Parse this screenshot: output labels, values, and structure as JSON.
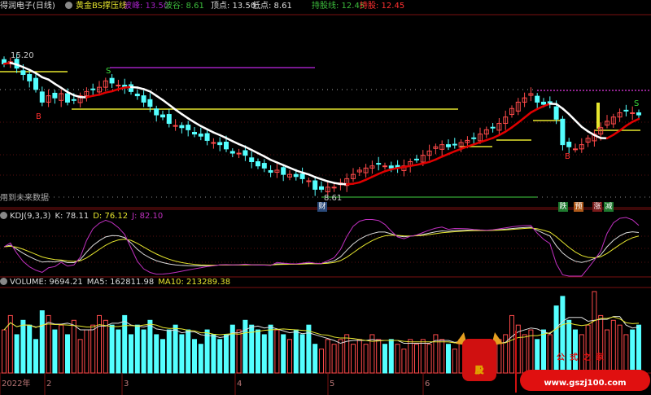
{
  "header": {
    "stock": "得润电子(日线)",
    "indicator": "黄金BS撑压线",
    "peak_label": "波峰: 13.50",
    "trough_label": "波谷: 8.61",
    "top_label": "顶点: 13.50",
    "bottom_label": "低点: 8.61",
    "hold_line_label": "持股线: 12.45",
    "hold_label": "持股: 12.45"
  },
  "main": {
    "high_marker": "15.20",
    "low_marker": "8.61",
    "future_warning": "用到未来数据",
    "signals": {
      "buy": "B",
      "sell": "S"
    },
    "badges": [
      "财",
      "跌",
      "预",
      "涨",
      "减"
    ],
    "colors": {
      "up": "#ff4a4a",
      "down": "#54ffff",
      "ma_fall": "#ffffff",
      "ma_rise": "#e00000",
      "support": "#e6e62e",
      "resist": "#a020c0"
    }
  },
  "kdj": {
    "title": "KDJ(9,3,3)",
    "k": "K: 78.11",
    "d": "D: 76.12",
    "j": "J: 82.10"
  },
  "volume": {
    "title": "VOLUME: 9694.21",
    "ma5": "MA5: 162811.98",
    "ma10": "MA10: 213289.38"
  },
  "axis": {
    "labels": [
      "2022年",
      "2",
      "3",
      "4",
      "5",
      "6"
    ]
  },
  "watermark": {
    "char": "股",
    "name": "公式之家",
    "url": "www.gszj100.com"
  },
  "chart_data": {
    "type": "candlestick",
    "closes": [
      14.8,
      14.9,
      14.6,
      14.3,
      14.0,
      13.6,
      13.0,
      13.3,
      13.2,
      13.4,
      13.0,
      13.1,
      13.3,
      13.5,
      13.6,
      13.7,
      14.0,
      13.9,
      13.8,
      13.7,
      13.5,
      13.3,
      13.0,
      12.8,
      12.4,
      12.3,
      12.0,
      11.9,
      11.8,
      11.7,
      11.5,
      11.4,
      11.2,
      11.1,
      11.0,
      10.8,
      10.6,
      10.6,
      10.5,
      10.2,
      10.0,
      9.9,
      9.7,
      9.8,
      9.6,
      9.6,
      9.5,
      9.4,
      9.3,
      8.9,
      8.9,
      9.0,
      9.0,
      9.2,
      9.4,
      9.6,
      9.8,
      9.9,
      10.0,
      10.1,
      10.0,
      9.9,
      9.9,
      10.0,
      10.2,
      10.3,
      10.5,
      10.7,
      10.9,
      11.0,
      10.9,
      11.0,
      11.1,
      11.2,
      11.3,
      11.5,
      11.7,
      11.8,
      12.0,
      12.3,
      12.7,
      13.0,
      13.2,
      13.4,
      13.0,
      12.9,
      12.9,
      12.2,
      11.0,
      10.9,
      10.8,
      11.0,
      11.3,
      11.5,
      11.8,
      12.1,
      12.3,
      12.5,
      12.6,
      12.5,
      12.4
    ],
    "volumes": [
      9,
      12,
      8,
      11,
      10,
      7,
      13,
      12,
      9,
      10,
      8,
      11,
      7,
      9,
      10,
      12,
      11,
      10,
      9,
      12,
      8,
      10,
      9,
      11,
      8,
      7,
      9,
      10,
      8,
      9,
      7,
      6,
      9,
      8,
      7,
      8,
      10,
      9,
      11,
      10,
      9,
      8,
      10,
      9,
      8,
      7,
      9,
      8,
      10,
      6,
      5,
      7,
      6,
      7,
      8,
      6,
      7,
      6,
      8,
      7,
      6,
      7,
      6,
      5,
      7,
      6,
      7,
      6,
      8,
      7,
      6,
      5,
      7,
      6,
      7,
      6,
      5,
      6,
      7,
      8,
      12,
      10,
      8,
      9,
      7,
      9,
      8,
      14,
      16,
      11,
      9,
      8,
      10,
      17,
      12,
      9,
      11,
      10,
      8,
      9,
      10
    ],
    "ylim": [
      8.2,
      15.6
    ]
  }
}
